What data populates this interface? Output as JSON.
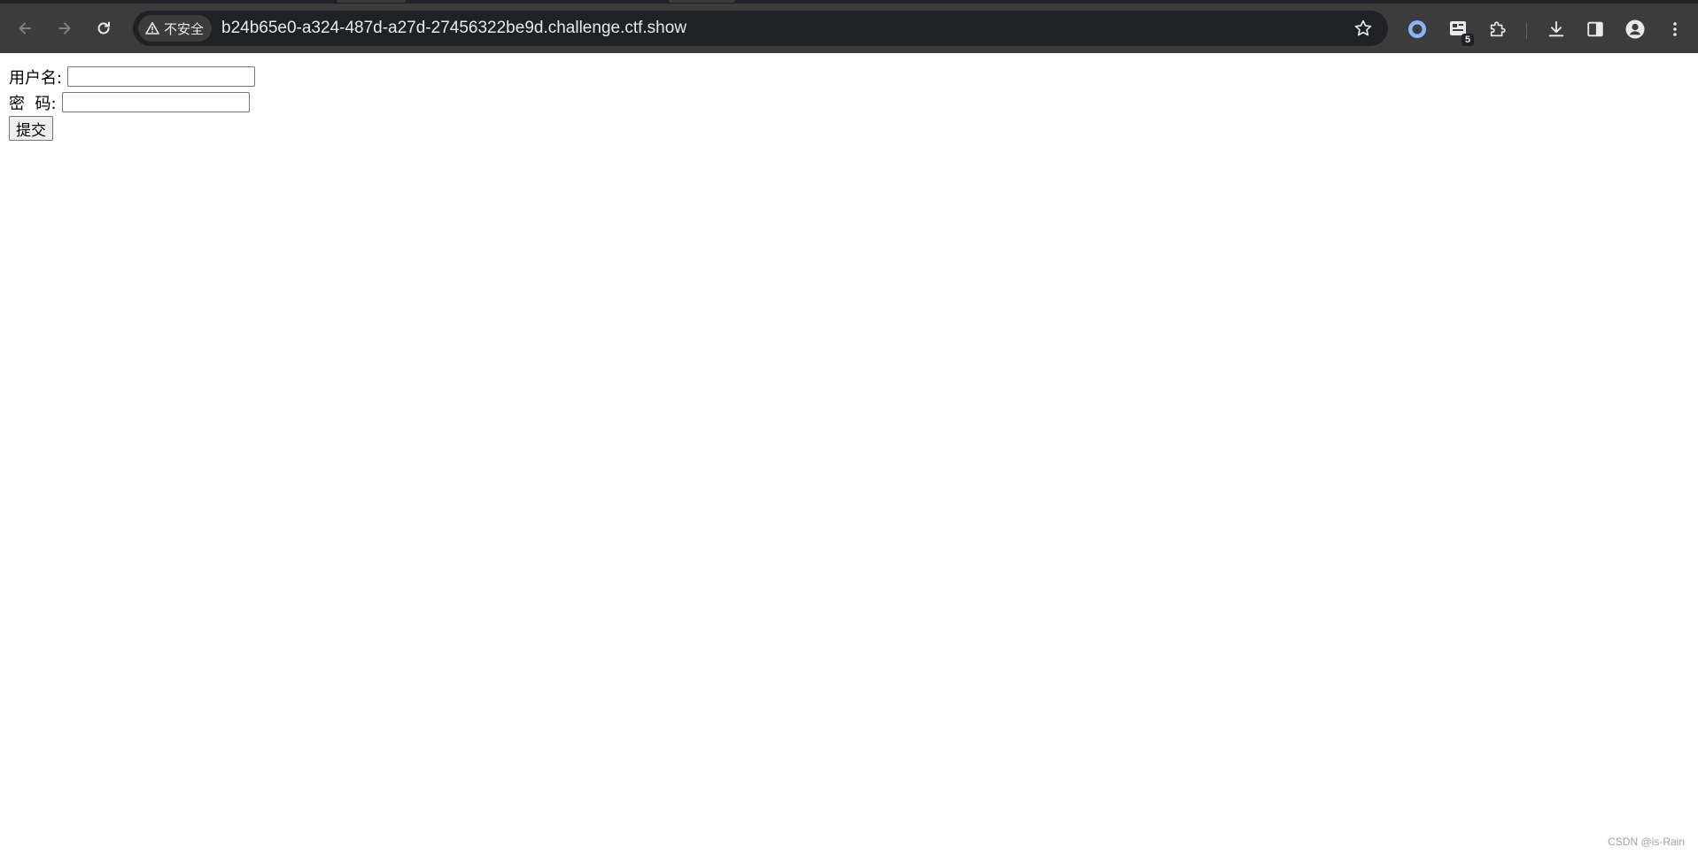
{
  "browser": {
    "security_label": "不安全",
    "url": "b24b65e0-a324-487d-a27d-27456322be9d.challenge.ctf.show",
    "extension_badge": "5",
    "icons": {
      "back": "arrow-left-icon",
      "forward": "arrow-right-icon",
      "reload": "reload-icon",
      "security": "warning-triangle-icon",
      "bookmark": "star-icon",
      "extension_a": "ring-icon",
      "extension_b": "extension-badge-icon",
      "extensions": "puzzle-icon",
      "downloads": "download-icon",
      "side_panel": "side-panel-icon",
      "profile": "profile-icon",
      "menu": "kebab-menu-icon"
    },
    "colors": {
      "toolbar": "#3c3c3c",
      "omnibox": "#202124",
      "text": "#e8eaed",
      "accent": "#8ab4f8"
    }
  },
  "form": {
    "username_label": "用户名:",
    "username_value": "",
    "password_label": "密  码:",
    "password_value": "",
    "submit_label": "提交"
  },
  "watermark": "CSDN @is-Rain"
}
